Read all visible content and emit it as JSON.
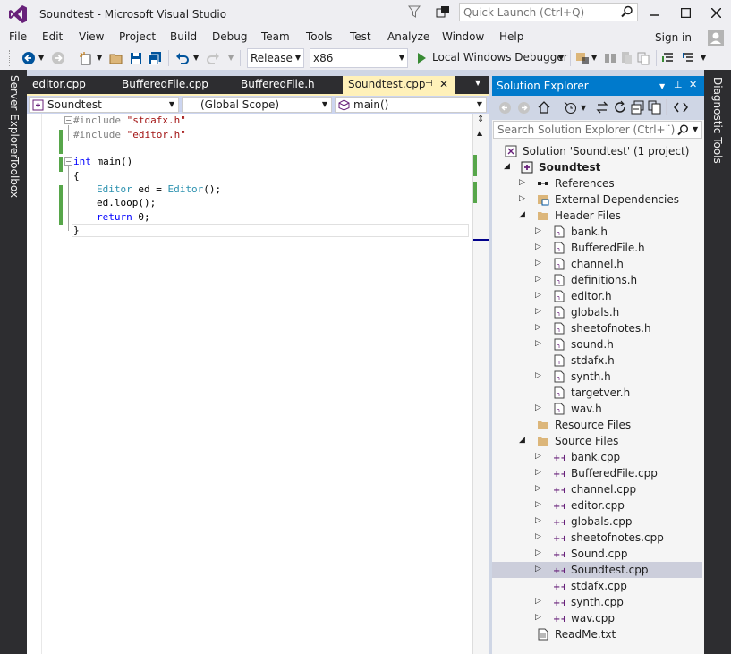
{
  "window": {
    "title": "Soundtest - Microsoft Visual Studio",
    "quick_launch_placeholder": "Quick Launch (Ctrl+Q)"
  },
  "menu": {
    "items": [
      "File",
      "Edit",
      "View",
      "Project",
      "Build",
      "Debug",
      "Team",
      "Tools",
      "Test",
      "Analyze",
      "Window",
      "Help"
    ],
    "sign_in": "Sign in"
  },
  "toolbar": {
    "configuration": "Release",
    "platform": "x86",
    "debugger": "Local Windows Debugger"
  },
  "side_tabs": {
    "left": [
      "Server Explorer",
      "Toolbox"
    ],
    "right": [
      "Diagnostic Tools"
    ]
  },
  "doc_tabs": [
    {
      "label": "editor.cpp",
      "active": false
    },
    {
      "label": "BufferedFile.cpp",
      "active": false
    },
    {
      "label": "BufferedFile.h",
      "active": false
    },
    {
      "label": "Soundtest.cpp",
      "active": true
    }
  ],
  "navbar": {
    "project": "Soundtest",
    "scope": "(Global Scope)",
    "member": "main()"
  },
  "code": {
    "line1_pp": "#include ",
    "line1_str": "\"stdafx.h\"",
    "line2_pp": "#include ",
    "line2_str": "\"editor.h\"",
    "line4_kw": "int",
    "line4_rest": " main()",
    "line5": "{",
    "line6_type1": "Editor",
    "line6_mid": " ed = ",
    "line6_type2": "Editor",
    "line6_end": "();",
    "line7": "ed.loop();",
    "line8_kw": "return",
    "line8_rest": " 0;",
    "line9": "}"
  },
  "solution_explorer": {
    "title": "Solution Explorer",
    "search_placeholder": "Search Solution Explorer (Ctrl+¨)",
    "solution": "Solution 'Soundtest' (1 project)",
    "project": "Soundtest",
    "references": "References",
    "external_deps": "External Dependencies",
    "header_files": "Header Files",
    "headers": [
      "bank.h",
      "BufferedFile.h",
      "channel.h",
      "definitions.h",
      "editor.h",
      "globals.h",
      "sheetofnotes.h",
      "sound.h",
      "stdafx.h",
      "synth.h",
      "targetver.h",
      "wav.h"
    ],
    "resource_files": "Resource Files",
    "source_files": "Source Files",
    "sources": [
      "bank.cpp",
      "BufferedFile.cpp",
      "channel.cpp",
      "editor.cpp",
      "globals.cpp",
      "sheetofnotes.cpp",
      "Sound.cpp",
      "Soundtest.cpp",
      "stdafx.cpp",
      "synth.cpp",
      "wav.cpp"
    ],
    "readme": "ReadMe.txt",
    "selected": "Soundtest.cpp"
  },
  "colors": {
    "accent": "#007acc",
    "vs_purple": "#68217a",
    "active_tab": "#fff1b9",
    "chrome_dark": "#2d2d30"
  }
}
